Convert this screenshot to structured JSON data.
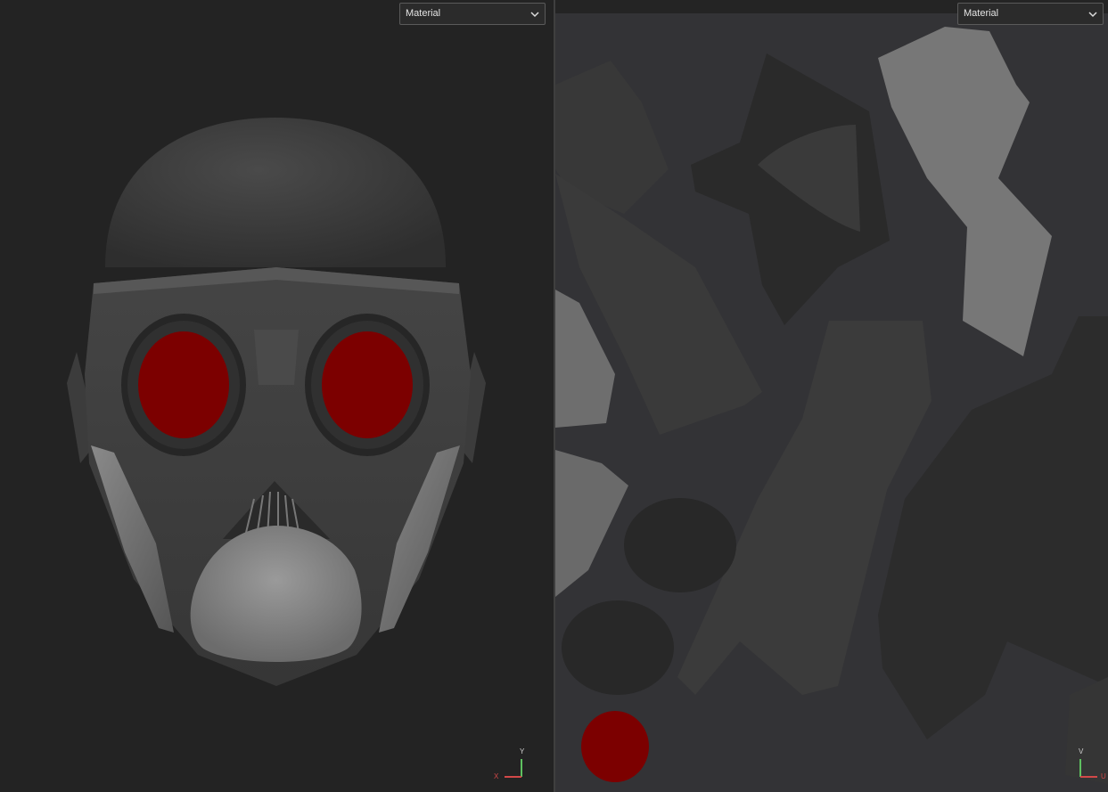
{
  "left_viewport": {
    "material_dropdown": {
      "selected": "Material"
    },
    "axis_gizmo": {
      "y_label": "Y",
      "x_label": "X"
    }
  },
  "right_viewport": {
    "material_dropdown": {
      "selected": "Material"
    },
    "axis_gizmo": {
      "v_label": "V",
      "u_label": "U"
    }
  },
  "colors": {
    "eye_red": "#7c0000",
    "mask_dark": "#404040",
    "mask_light": "#8c8c8c",
    "axis_x": "#d24848",
    "axis_y": "#5ec060"
  }
}
